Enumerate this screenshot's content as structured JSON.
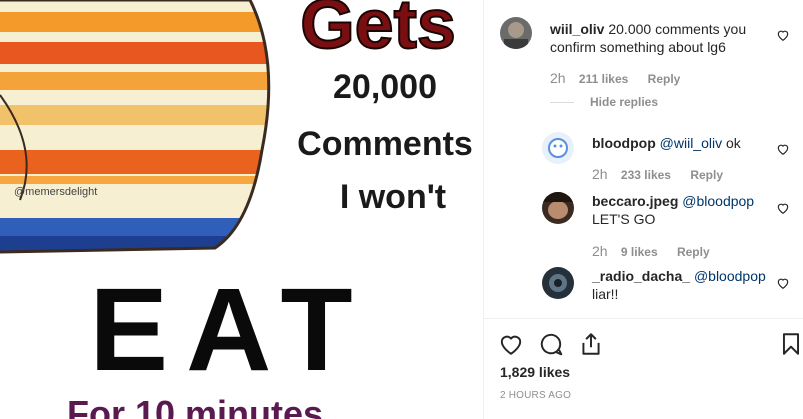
{
  "post": {
    "overlay_top": "Gets",
    "overlay_line1": "20,000",
    "overlay_line2": "Comments",
    "overlay_line3": "I won't",
    "big_word": "EAT",
    "watermark": "@memersdelight",
    "bottom_partial": "For 10 minutes"
  },
  "comments": [
    {
      "username": "wiil_oliv",
      "text": "20.000 comments you confirm something about lg6",
      "time": "2h",
      "likes": "211 likes",
      "reply": "Reply",
      "hide_replies": "Hide replies"
    },
    {
      "username": "bloodpop",
      "mention": "@wiil_oliv",
      "text": "ok",
      "time": "2h",
      "likes": "233 likes",
      "reply": "Reply"
    },
    {
      "username": "beccaro.jpeg",
      "mention": "@bloodpop",
      "text": "LET'S GO",
      "time": "2h",
      "likes": "9 likes",
      "reply": "Reply"
    },
    {
      "username": "_radio_dacha_",
      "mention": "@bloodpop",
      "text": "liar!!"
    }
  ],
  "actions": {
    "like_icon": "heart-icon",
    "comment_icon": "comment-icon",
    "share_icon": "share-icon",
    "save_icon": "bookmark-icon"
  },
  "stats": {
    "likes_total": "1,829 likes",
    "posted": "2 HOURS AGO"
  },
  "colors": {
    "text": "#262626",
    "meta": "#8e8e8e",
    "mention": "#003569",
    "border": "#efefef"
  }
}
